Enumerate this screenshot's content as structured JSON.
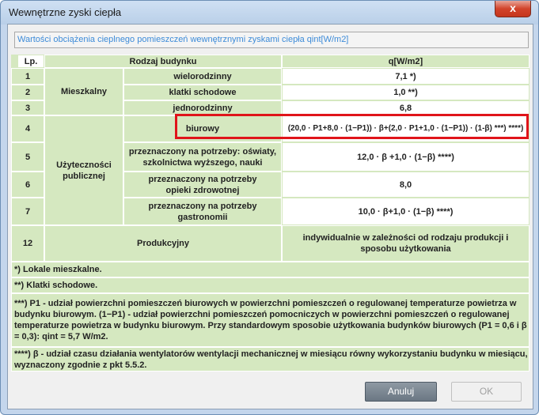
{
  "window": {
    "title": "Wewnętrzne zyski ciepła",
    "close_label": "x"
  },
  "header_text": "Wartości obciążenia cieplnego pomieszczeń wewnętrznymi zyskami ciepła qint[W/m2]",
  "table": {
    "col_lp": "Lp.",
    "col_type": "Rodzaj budynku",
    "col_q": "q[W/m2]",
    "rows": [
      {
        "lp": "1",
        "sub": "wielorodzinny",
        "q": "7,1 *)"
      },
      {
        "lp": "2",
        "sub": "klatki schodowe",
        "q": "1,0 **)"
      },
      {
        "lp": "3",
        "sub": "jednorodzinny",
        "q": "6,8"
      },
      {
        "lp": "4",
        "sub": "biurowy",
        "q": "(20,0 · P1+8,0 · (1−P1)) · β+(2,0 · P1+1,0 · (1−P1)) · (1-β) ***) ****)"
      },
      {
        "lp": "5",
        "sub": "przeznaczony na potrzeby: oświaty, szkolnictwa wyższego, nauki",
        "q": "12,0 · β +1,0 · (1−β) ****)"
      },
      {
        "lp": "6",
        "sub": "przeznaczony na potrzeby opieki zdrowotnej",
        "q": "8,0"
      },
      {
        "lp": "7",
        "sub": "przeznaczony na potrzeby gastronomii",
        "q": "10,0 · β+1,0 · (1−β) ****)"
      },
      {
        "lp": "12",
        "sub": "Produkcyjny",
        "q": "indywidualnie w zależności od rodzaju produkcji i sposobu użytkowania"
      }
    ],
    "group_residential": "Mieszkalny",
    "group_public": "Użyteczności publicznej"
  },
  "notes": [
    "*) Lokale mieszkalne.",
    "**) Klatki schodowe.",
    "***) P1 - udział powierzchni pomieszczeń biurowych w powierzchni pomieszczeń o regulowanej temperaturze powietrza w budynku biurowym. (1−P1) - udział powierzchni pomieszczeń pomocniczych w powierzchni pomieszczeń o regulowanej temperaturze powietrza w budynku biurowym. Przy standardowym sposobie użytkowania budynków biurowych (P1 = 0,6 i β = 0,3): qint = 5,7 W/m2.",
    "****) β - udział czasu działania wentylatorów wentylacji mechanicznej w miesiącu równy wykorzystaniu budynku w miesiącu, wyznaczony zgodnie z pkt 5.5.2."
  ],
  "buttons": {
    "cancel": "Anuluj",
    "ok": "OK"
  },
  "colors": {
    "table_bg": "#d5e8c0",
    "highlight": "#e0141a",
    "header_text": "#3d8bd8"
  }
}
